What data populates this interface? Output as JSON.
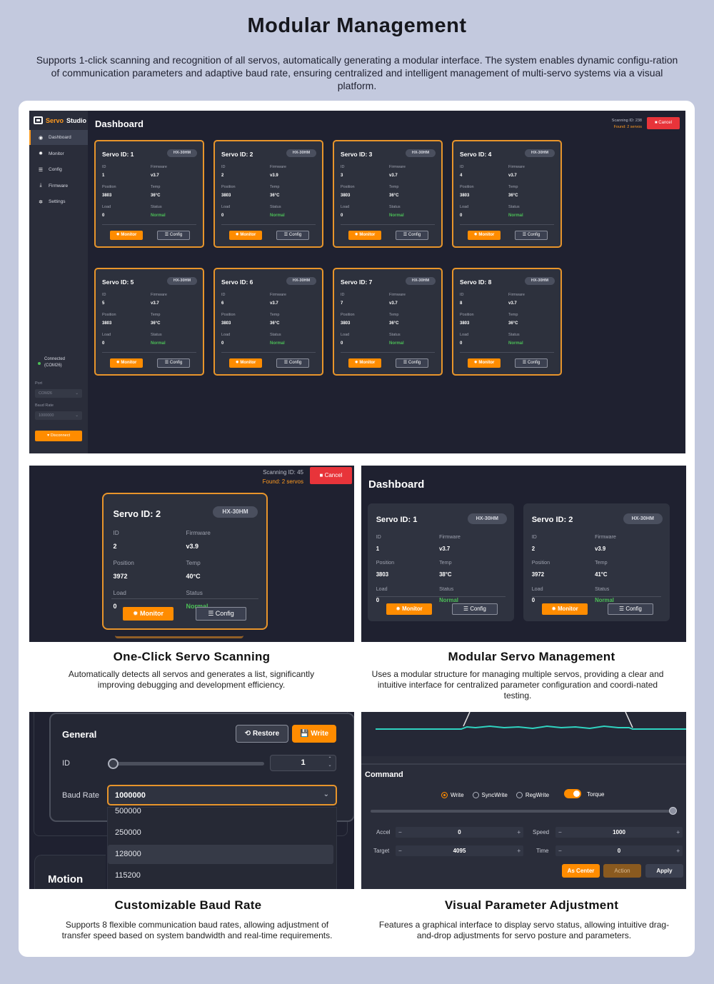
{
  "hero": {
    "title": "Modular Management",
    "description": "Supports 1-click scanning and recognition of all servos, automatically generating a modular interface. The system enables dynamic configu-ration of communication parameters and adaptive baud rate, ensuring centralized and intelligent management of multi-servo systems via a visual platform."
  },
  "app": {
    "logo_a": "Servo",
    "logo_b": "Studio",
    "dashboard_title": "Dashboard",
    "scan_status": "Scanning ID: 238",
    "found": "Found: 2 servos",
    "cancel": "Cancel"
  },
  "nav": [
    {
      "label": "Dashboard",
      "icon": "◉"
    },
    {
      "label": "Monitor",
      "icon": "✹"
    },
    {
      "label": "Config",
      "icon": "☰"
    },
    {
      "label": "Firmware",
      "icon": "⤓"
    },
    {
      "label": "Settings",
      "icon": "✲"
    }
  ],
  "connection": {
    "status_line1": "Connected",
    "status_line2": "(COM26)",
    "port_label": "Port",
    "port_value": "COM26",
    "baud_label": "Baud Rate",
    "baud_value": "1000000",
    "disconnect": "Disconnect"
  },
  "field_labels": {
    "id": "ID",
    "firmware": "Firmware",
    "position": "Position",
    "temp": "Temp",
    "load": "Load",
    "status": "Status"
  },
  "buttons": {
    "monitor": "Monitor",
    "config": "Config"
  },
  "servos": [
    {
      "title": "Servo ID: 1",
      "model": "HX-30HM",
      "id": "1",
      "firmware": "v3.7",
      "position": "3803",
      "temp": "36°C",
      "load": "0",
      "status": "Normal"
    },
    {
      "title": "Servo ID: 2",
      "model": "HX-30HM",
      "id": "2",
      "firmware": "v3.9",
      "position": "3803",
      "temp": "36°C",
      "load": "0",
      "status": "Normal"
    },
    {
      "title": "Servo ID: 3",
      "model": "HX-30HM",
      "id": "3",
      "firmware": "v3.7",
      "position": "3803",
      "temp": "36°C",
      "load": "0",
      "status": "Normal"
    },
    {
      "title": "Servo ID: 4",
      "model": "HX-30HM",
      "id": "4",
      "firmware": "v3.7",
      "position": "3803",
      "temp": "36°C",
      "load": "0",
      "status": "Normal"
    },
    {
      "title": "Servo ID: 5",
      "model": "HX-30HM",
      "id": "5",
      "firmware": "v3.7",
      "position": "3803",
      "temp": "36°C",
      "load": "0",
      "status": "Normal"
    },
    {
      "title": "Servo ID: 6",
      "model": "HX-30HM",
      "id": "6",
      "firmware": "v3.7",
      "position": "3803",
      "temp": "36°C",
      "load": "0",
      "status": "Normal"
    },
    {
      "title": "Servo ID: 7",
      "model": "HX-30HM",
      "id": "7",
      "firmware": "v3.7",
      "position": "3803",
      "temp": "36°C",
      "load": "0",
      "status": "Normal"
    },
    {
      "title": "Servo ID: 8",
      "model": "HX-30HM",
      "id": "8",
      "firmware": "v3.7",
      "position": "3803",
      "temp": "36°C",
      "load": "0",
      "status": "Normal"
    }
  ],
  "scan_panel": {
    "scan_status": "Scanning ID: 45",
    "found": "Found: 2 servos",
    "cancel": "Cancel",
    "servo": {
      "title": "Servo ID: 2",
      "model": "HX-30HM",
      "id": "2",
      "firmware": "v3.9",
      "position": "3972",
      "temp": "40°C",
      "load": "0",
      "status": "Normal"
    }
  },
  "modular_panel": {
    "title": "Dashboard",
    "servos": [
      {
        "title": "Servo ID: 1",
        "model": "HX-30HM",
        "id": "1",
        "firmware": "v3.7",
        "position": "3803",
        "temp": "38°C",
        "load": "0",
        "status": "Normal"
      },
      {
        "title": "Servo ID: 2",
        "model": "HX-30HM",
        "id": "2",
        "firmware": "v3.9",
        "position": "3972",
        "temp": "41°C",
        "load": "0",
        "status": "Normal"
      }
    ]
  },
  "baud_panel": {
    "section": "General",
    "restore": "Restore",
    "write": "Write",
    "id_label": "ID",
    "id_value": "1",
    "baud_label": "Baud Rate",
    "baud_selected": "1000000",
    "options": [
      "500000",
      "250000",
      "128000",
      "115200"
    ],
    "motion": "Motion"
  },
  "command_panel": {
    "title": "Command",
    "modes": [
      "Write",
      "SyncWrite",
      "RegWrite"
    ],
    "torque": "Torque",
    "accel_label": "Accel",
    "accel_value": "0",
    "speed_label": "Speed",
    "speed_value": "1000",
    "target_label": "Target",
    "target_value": "4095",
    "time_label": "Time",
    "time_value": "0",
    "as_center": "As Center",
    "action": "Action",
    "apply": "Apply"
  },
  "captions": [
    {
      "title": "One-Click Servo Scanning",
      "desc": "Automatically detects all servos and generates a list, significantly improving debugging and development efficiency."
    },
    {
      "title": "Modular Servo Management",
      "desc": "Uses a modular structure for managing multiple servos, providing a clear and intuitive interface for centralized parameter configuration and coordi-nated testing."
    },
    {
      "title": "Customizable Baud Rate",
      "desc": "Supports 8 flexible communication baud rates, allowing adjustment of transfer speed based on system bandwidth and real-time requirements."
    },
    {
      "title": "Visual Parameter Adjustment",
      "desc": "Features a graphical interface to display servo status, allowing intuitive drag-and-drop adjustments for servo posture and parameters."
    }
  ],
  "colors": {
    "accent": "#ff8c00",
    "card_border": "#e8952b",
    "status_green": "#4cbf57",
    "cancel_red": "#e8343a",
    "panel": "#1f2130"
  }
}
